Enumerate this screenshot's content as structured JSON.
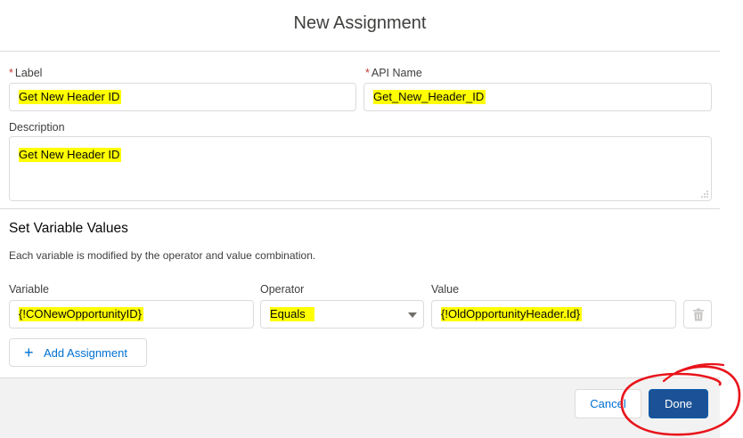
{
  "modal": {
    "title": "New Assignment"
  },
  "fields": {
    "label": {
      "label": "Label",
      "required_marker": "*",
      "value": "Get New Header ID"
    },
    "api_name": {
      "label": "API Name",
      "required_marker": "*",
      "value": "Get_New_Header_ID"
    },
    "description": {
      "label": "Description",
      "value": "Get New Header ID"
    }
  },
  "section": {
    "title": "Set Variable Values",
    "description": "Each variable is modified by the operator and value combination."
  },
  "assignment_row": {
    "variable_label": "Variable",
    "variable_value": "{!CONewOpportunityID}",
    "operator_label": "Operator",
    "operator_value": "Equals",
    "value_label": "Value",
    "value_value": "{!OldOpportunityHeader.Id}",
    "delete_icon": "trash-icon"
  },
  "add_assignment": {
    "label": "Add Assignment",
    "icon": "plus-icon"
  },
  "footer": {
    "cancel_label": "Cancel",
    "done_label": "Done"
  },
  "colors": {
    "highlight": "#ffff00",
    "primary_button": "#1b5297",
    "link_blue": "#0070d2",
    "required": "#c23934",
    "annotation_red": "#e8141b"
  }
}
